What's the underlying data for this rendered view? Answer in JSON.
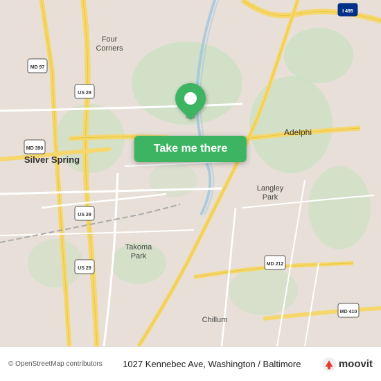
{
  "map": {
    "center_lat": 38.9897,
    "center_lon": -77.0086,
    "zoom": 12
  },
  "cta": {
    "label": "Take me there"
  },
  "bottom_bar": {
    "copyright": "© OpenStreetMap contributors",
    "address": "1027 Kennebec Ave, Washington / Baltimore",
    "moovit_label": "moovit"
  },
  "map_labels": {
    "four_corners": "Four\nCorners",
    "silver_spring": "Silver Spring",
    "adelphi": "Adelphi",
    "langley_park": "Langley\nPark",
    "takoma_park": "Takoma\nPark",
    "chillum": "Chillum",
    "us29_1": "US 29",
    "us29_2": "US 29",
    "us29_3": "US 29",
    "md97": "MD 97",
    "md390": "MD 390",
    "md212": "MD 212",
    "md410": "MD 410",
    "i495": "I 495"
  },
  "colors": {
    "map_bg": "#e8e0d8",
    "green_area": "#c8dfc0",
    "road_yellow": "#f5d76e",
    "road_white": "#ffffff",
    "road_gray": "#cccccc",
    "pin_green": "#3cb461",
    "text_dark": "#333333",
    "text_gray": "#666666"
  }
}
